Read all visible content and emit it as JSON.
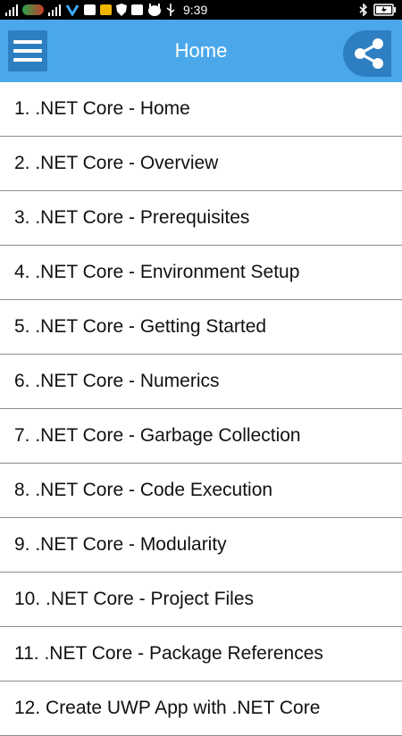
{
  "status_bar": {
    "time": "9:39",
    "icons": [
      "signal-icon",
      "carrier-logo",
      "signal-icon",
      "network-icon",
      "gmail-icon",
      "notification-icon",
      "shield-icon",
      "facebook-icon",
      "android-icon",
      "usb-icon",
      "bluetooth-icon",
      "battery-charging-icon"
    ],
    "colors": {
      "background": "#000000"
    }
  },
  "app_bar": {
    "title": "Home",
    "menu_icon": "hamburger-menu-icon",
    "share_icon": "share-icon",
    "colors": {
      "background": "#4aa8ea",
      "button": "#2d7fc2"
    }
  },
  "list": {
    "items": [
      {
        "label": "1. .NET Core - Home"
      },
      {
        "label": "2. .NET Core - Overview"
      },
      {
        "label": "3. .NET Core - Prerequisites"
      },
      {
        "label": "4. .NET Core - Environment Setup"
      },
      {
        "label": "5. .NET Core - Getting Started"
      },
      {
        "label": "6. .NET Core - Numerics"
      },
      {
        "label": "7. .NET Core - Garbage Collection"
      },
      {
        "label": "8. .NET Core - Code Execution"
      },
      {
        "label": "9. .NET Core - Modularity"
      },
      {
        "label": "10. .NET Core - Project Files"
      },
      {
        "label": "11. .NET Core - Package References"
      },
      {
        "label": "12. Create UWP App with .NET Core"
      }
    ]
  }
}
